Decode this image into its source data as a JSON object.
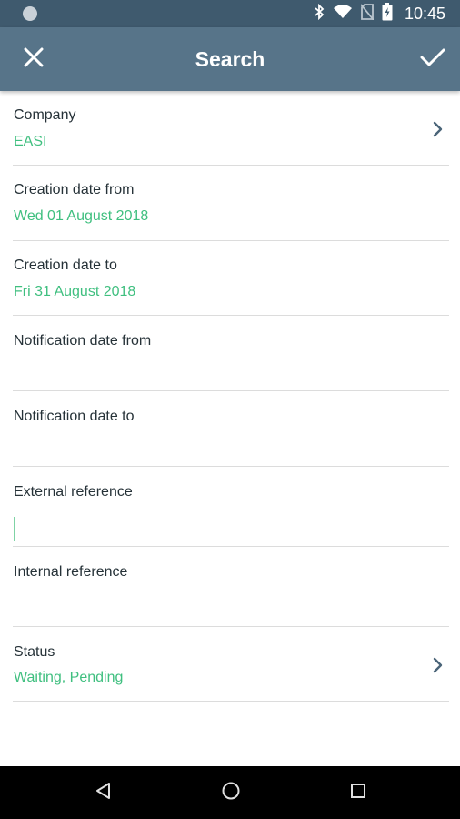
{
  "status_bar": {
    "time": "10:45"
  },
  "app_bar": {
    "title": "Search"
  },
  "form": {
    "company": {
      "label": "Company",
      "value": "EASI"
    },
    "creation_from": {
      "label": "Creation date from",
      "value": "Wed 01 August 2018"
    },
    "creation_to": {
      "label": "Creation date to",
      "value": "Fri 31 August 2018"
    },
    "notification_from": {
      "label": "Notification date from",
      "value": ""
    },
    "notification_to": {
      "label": "Notification date to",
      "value": ""
    },
    "external_reference": {
      "label": "External reference",
      "value": ""
    },
    "internal_reference": {
      "label": "Internal reference",
      "value": ""
    },
    "status": {
      "label": "Status",
      "value": "Waiting, Pending"
    }
  },
  "colors": {
    "status_bar": "#3f5a6e",
    "app_bar": "#577489",
    "accent_value": "#3fbf7f",
    "label_text": "#263238",
    "chevron": "#4a6478"
  },
  "icons": {
    "close": "close-icon",
    "confirm": "check-icon",
    "chevron": "chevron-right-icon",
    "nav_back": "back-triangle-icon",
    "nav_home": "home-circle-icon",
    "nav_recents": "recents-square-icon"
  }
}
